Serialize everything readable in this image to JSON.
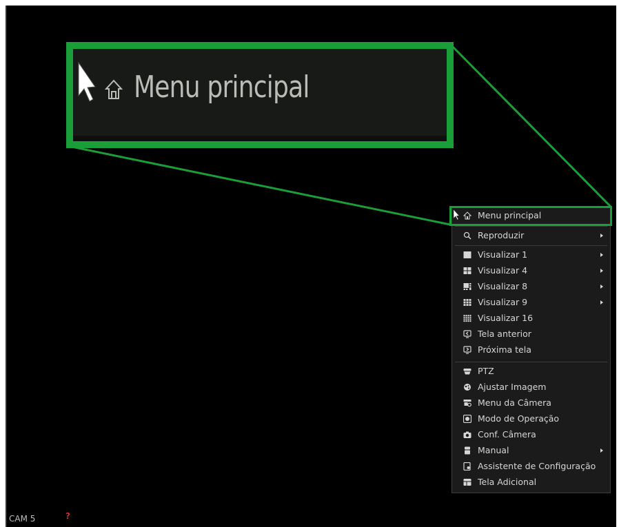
{
  "zoom_callout": {
    "label": "Menu principal",
    "icon": "home-icon"
  },
  "context_menu": {
    "items": [
      {
        "label": "Menu principal",
        "icon": "home-icon",
        "submenu": false
      },
      {
        "label": "Reproduzir",
        "icon": "search-icon",
        "submenu": true
      },
      {
        "label": "Visualizar 1",
        "icon": "single-view-icon",
        "submenu": true
      },
      {
        "label": "Visualizar 4",
        "icon": "quad-view-icon",
        "submenu": true
      },
      {
        "label": "Visualizar 8",
        "icon": "eight-view-icon",
        "submenu": true
      },
      {
        "label": "Visualizar 9",
        "icon": "nine-view-icon",
        "submenu": true
      },
      {
        "label": "Visualizar 16",
        "icon": "sixteen-view-icon",
        "submenu": false
      },
      {
        "label": "Tela anterior",
        "icon": "previous-screen-icon",
        "submenu": false
      },
      {
        "label": "Próxima tela",
        "icon": "next-screen-icon",
        "submenu": false
      },
      {
        "label": "PTZ",
        "icon": "ptz-icon",
        "submenu": false
      },
      {
        "label": "Ajustar Imagem",
        "icon": "image-adjust-icon",
        "submenu": false
      },
      {
        "label": "Menu da Câmera",
        "icon": "camera-menu-icon",
        "submenu": false
      },
      {
        "label": "Modo de Operação",
        "icon": "operation-mode-icon",
        "submenu": false
      },
      {
        "label": "Conf. Câmera",
        "icon": "camera-settings-icon",
        "submenu": false
      },
      {
        "label": "Manual",
        "icon": "manual-icon",
        "submenu": true
      },
      {
        "label": "Assistente de Configuração",
        "icon": "setup-wizard-icon",
        "submenu": false
      },
      {
        "label": "Tela Adicional",
        "icon": "additional-screen-icon",
        "submenu": false
      }
    ]
  },
  "status_bar": {
    "camera_label": "CAM 5",
    "indicator": "?"
  },
  "colors": {
    "highlight_green": "#1a9e3a",
    "menu_bg": "#1a1b1a",
    "menu_text": "#d6d6d6",
    "alert_red": "#d42a2a"
  }
}
